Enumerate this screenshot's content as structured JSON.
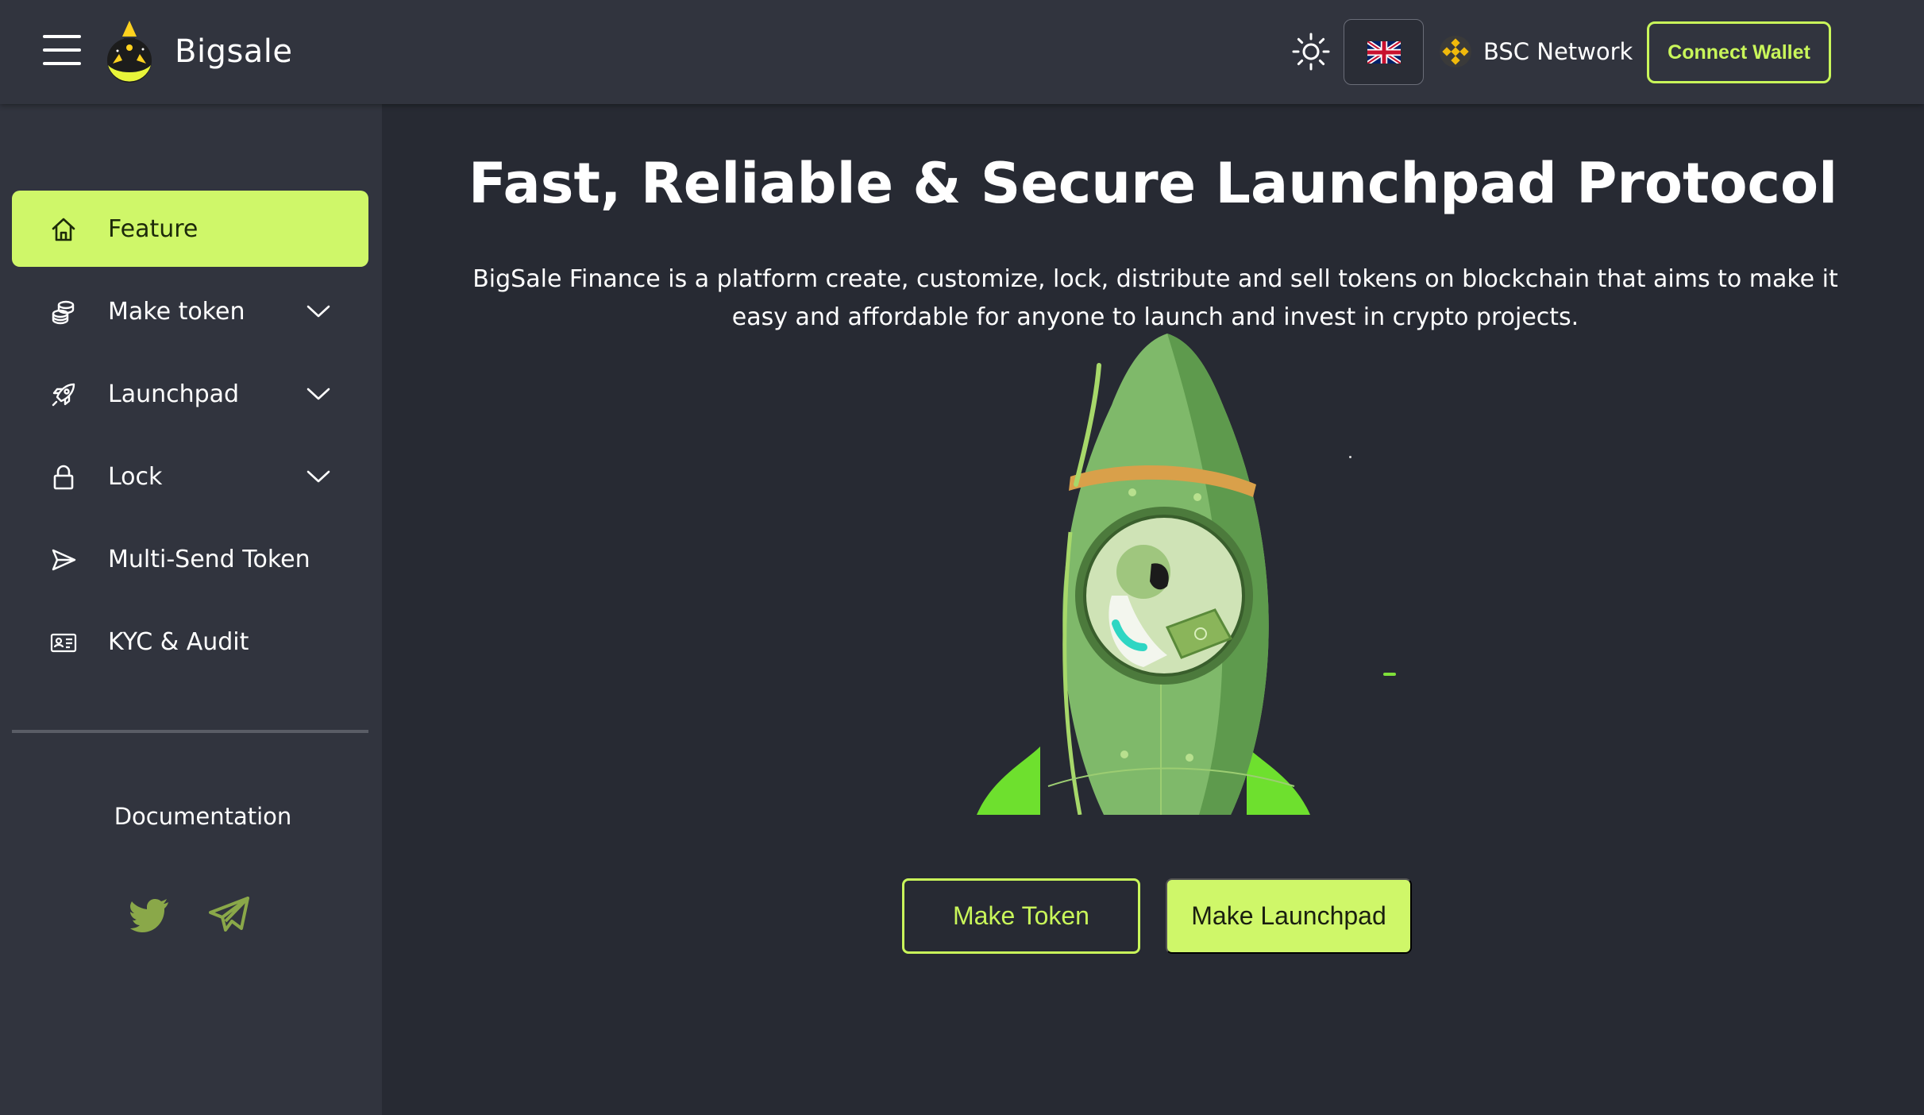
{
  "header": {
    "brand": "Bigsale",
    "language": "English (UK)",
    "network_label": "BSC Network",
    "connect_label": "Connect Wallet"
  },
  "sidebar": {
    "items": [
      {
        "label": "Feature",
        "icon": "home-icon",
        "active": true
      },
      {
        "label": "Make token",
        "icon": "coins-icon",
        "expandable": true
      },
      {
        "label": "Launchpad",
        "icon": "rocket-icon",
        "expandable": true
      },
      {
        "label": "Lock",
        "icon": "lock-icon",
        "expandable": true
      },
      {
        "label": "Multi-Send Token",
        "icon": "send-icon"
      },
      {
        "label": "KYC & Audit",
        "icon": "id-card-icon"
      }
    ],
    "documentation_label": "Documentation",
    "social": [
      "twitter-icon",
      "telegram-icon"
    ]
  },
  "main": {
    "title": "Fast, Reliable & Secure Launchpad Protocol",
    "description": "BigSale Finance is a platform create, customize, lock, distribute and sell tokens on blockchain that aims to make it easy and affordable for anyone to launch and invest in crypto projects.",
    "make_token_label": "Make Token",
    "make_launchpad_label": "Make Launchpad"
  },
  "colors": {
    "accent": "#cff769",
    "background": "#272a33",
    "panel": "#31343e",
    "binance": "#f0b90b"
  }
}
